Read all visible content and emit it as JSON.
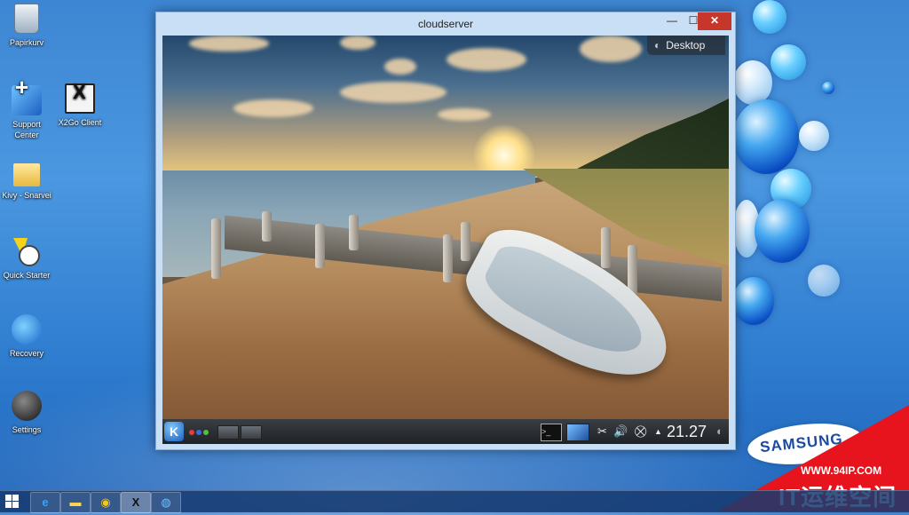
{
  "desktop": {
    "icons": [
      {
        "label": "Papirkurv",
        "icon": "recycle-bin-icon"
      },
      {
        "label": "Support Center",
        "icon": "support-center-icon"
      },
      {
        "label": "X2Go Client",
        "icon": "x2go-icon"
      },
      {
        "label": "Kivy - Snarvei",
        "icon": "folder-icon"
      },
      {
        "label": "Quick Starter",
        "icon": "quick-starter-icon"
      },
      {
        "label": "Recovery",
        "icon": "recovery-icon"
      },
      {
        "label": "Settings",
        "icon": "settings-icon"
      }
    ]
  },
  "window": {
    "title": "cloudserver",
    "buttons": {
      "minimize": "—",
      "maximize": "☐",
      "close": "✕"
    }
  },
  "remote": {
    "desktop_badge": "Desktop",
    "panel": {
      "launcher_icon": "kde-icon",
      "terminal_glyph": ">_",
      "clock": "21.27"
    }
  },
  "brand": {
    "samsung": "SAMSUNG",
    "watermark_url": "WWW.94IP.COM",
    "watermark_text": "IT运维空间"
  },
  "taskbar": {
    "items": [
      "ie-icon",
      "explorer-icon",
      "chrome-icon",
      "x2go-icon",
      "network-icon"
    ]
  },
  "colors": {
    "close_button": "#c7362b",
    "watermark_red": "#e7141e",
    "samsung_blue": "#1b4aa0"
  }
}
